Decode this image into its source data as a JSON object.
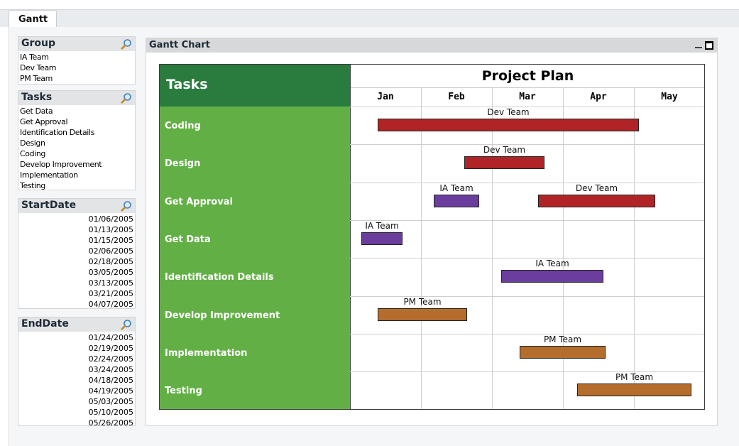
{
  "tab": {
    "label": "Gantt"
  },
  "listboxes": [
    {
      "title": "Group",
      "align": "left",
      "items": [
        "IA Team",
        "Dev Team",
        "PM Team"
      ]
    },
    {
      "title": "Tasks",
      "align": "left",
      "items": [
        "Get Data",
        "Get Approval",
        "Identification Details",
        "Design",
        "Coding",
        "Develop Improvement",
        "Implementation",
        "Testing"
      ]
    },
    {
      "title": "StartDate",
      "align": "right",
      "items": [
        "01/06/2005",
        "01/13/2005",
        "01/15/2005",
        "02/06/2005",
        "02/18/2005",
        "03/05/2005",
        "03/13/2005",
        "03/21/2005",
        "04/07/2005"
      ]
    },
    {
      "title": "EndDate",
      "align": "right",
      "items": [
        "01/24/2005",
        "02/19/2005",
        "02/24/2005",
        "03/24/2005",
        "04/18/2005",
        "04/19/2005",
        "05/03/2005",
        "05/10/2005",
        "05/26/2005"
      ]
    }
  ],
  "chart_panel": {
    "title": "Gantt Chart"
  },
  "chart_data": {
    "type": "gantt",
    "title": "Project Plan",
    "task_header": "Tasks",
    "months": [
      "Jan",
      "Feb",
      "Mar",
      "Apr",
      "May"
    ],
    "team_colors": {
      "Dev Team": "#b02326",
      "IA Team": "#6b3e9e",
      "PM Team": "#b46d2c"
    },
    "header_color": "#2a7b3e",
    "column_color": "#62b045",
    "tasks": [
      {
        "name": "Coding",
        "bars": [
          {
            "team": "Dev Team",
            "start": "01/13/2005",
            "end": "05/03/2005"
          }
        ]
      },
      {
        "name": "Design",
        "bars": [
          {
            "team": "Dev Team",
            "start": "02/18/2005",
            "end": "03/24/2005"
          }
        ]
      },
      {
        "name": "Get Approval",
        "bars": [
          {
            "team": "IA Team",
            "start": "02/06/2005",
            "end": "02/24/2005"
          },
          {
            "team": "Dev Team",
            "start": "03/21/2005",
            "end": "05/10/2005"
          }
        ]
      },
      {
        "name": "Get Data",
        "bars": [
          {
            "team": "IA Team",
            "start": "01/06/2005",
            "end": "01/24/2005"
          }
        ]
      },
      {
        "name": "Identification Details",
        "bars": [
          {
            "team": "IA Team",
            "start": "03/05/2005",
            "end": "04/18/2005"
          }
        ]
      },
      {
        "name": "Develop Improvement",
        "bars": [
          {
            "team": "PM Team",
            "start": "01/13/2005",
            "end": "02/19/2005"
          }
        ]
      },
      {
        "name": "Implementation",
        "bars": [
          {
            "team": "PM Team",
            "start": "03/13/2005",
            "end": "04/19/2005"
          }
        ]
      },
      {
        "name": "Testing",
        "bars": [
          {
            "team": "PM Team",
            "start": "04/07/2005",
            "end": "05/26/2005"
          }
        ]
      }
    ]
  }
}
